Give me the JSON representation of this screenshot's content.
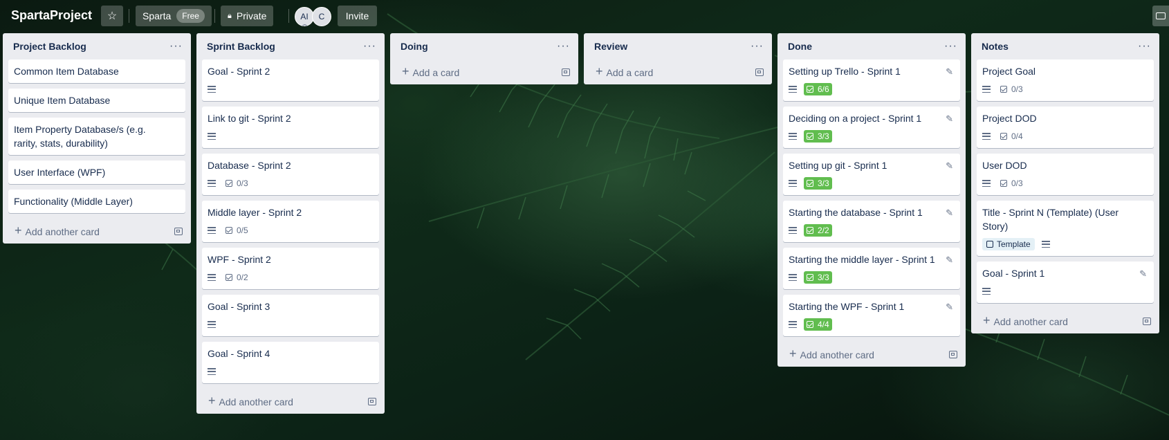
{
  "header": {
    "board_title": "SpartaProject",
    "workspace": "Sparta",
    "workspace_badge": "Free",
    "visibility": "Private",
    "members": [
      "AI",
      "C"
    ],
    "invite": "Invite"
  },
  "lists": [
    {
      "title": "Project Backlog",
      "cards": [
        {
          "title": "Common Item Database"
        },
        {
          "title": "Unique Item Database"
        },
        {
          "title": "Item Property Database/s (e.g. rarity, stats, durability)"
        },
        {
          "title": "User Interface (WPF)"
        },
        {
          "title": "Functionality (Middle Layer)"
        }
      ],
      "add_label": "Add another card"
    },
    {
      "title": "Sprint Backlog",
      "cards": [
        {
          "title": "Goal - Sprint 2",
          "desc": true
        },
        {
          "title": "Link to git - Sprint 2",
          "desc": true
        },
        {
          "title": "Database - Sprint 2",
          "desc": true,
          "checklist": "0/3"
        },
        {
          "title": "Middle layer - Sprint 2",
          "desc": true,
          "checklist": "0/5"
        },
        {
          "title": "WPF - Sprint 2",
          "desc": true,
          "checklist": "0/2"
        },
        {
          "title": "Goal - Sprint 3",
          "desc": true
        },
        {
          "title": "Goal - Sprint 4",
          "desc": true
        }
      ],
      "add_label": "Add another card"
    },
    {
      "title": "Doing",
      "cards": [],
      "add_label": "Add a card"
    },
    {
      "title": "Review",
      "cards": [],
      "add_label": "Add a card"
    },
    {
      "title": "Done",
      "cards": [
        {
          "title": "Setting up Trello - Sprint 1",
          "desc": true,
          "checklist": "6/6",
          "complete": true,
          "edit": true
        },
        {
          "title": "Deciding on a project - Sprint 1",
          "desc": true,
          "checklist": "3/3",
          "complete": true,
          "edit": true
        },
        {
          "title": "Setting up git - Sprint 1",
          "desc": true,
          "checklist": "3/3",
          "complete": true,
          "edit": true
        },
        {
          "title": "Starting the database - Sprint 1",
          "desc": true,
          "checklist": "2/2",
          "complete": true,
          "edit": true
        },
        {
          "title": "Starting the middle layer - Sprint 1",
          "desc": true,
          "checklist": "3/3",
          "complete": true,
          "edit": true
        },
        {
          "title": "Starting the WPF - Sprint 1",
          "desc": true,
          "checklist": "4/4",
          "complete": true,
          "edit": true
        }
      ],
      "add_label": "Add another card"
    },
    {
      "title": "Notes",
      "cards": [
        {
          "title": "Project Goal",
          "desc": true,
          "checklist": "0/3"
        },
        {
          "title": "Project DOD",
          "desc": true,
          "checklist": "0/4"
        },
        {
          "title": "User DOD",
          "desc": true,
          "checklist": "0/3"
        },
        {
          "title": "Title - Sprint N (Template) (User Story)",
          "template": "Template",
          "desc": true
        },
        {
          "title": "Goal - Sprint 1",
          "desc": true,
          "edit": true
        }
      ],
      "add_label": "Add another card"
    }
  ],
  "colors": {
    "complete_badge": "#61bd4f",
    "list_bg": "#ebecf0"
  }
}
